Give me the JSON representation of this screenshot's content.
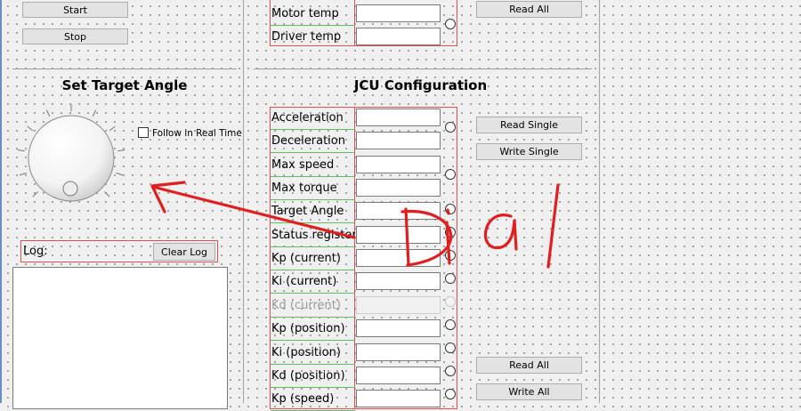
{
  "control_buttons": {
    "start": "Start",
    "stop": "Stop"
  },
  "monitor": {
    "rows": [
      {
        "label": "Motor temp"
      },
      {
        "label": "Driver temp"
      }
    ],
    "read_all": "Read All"
  },
  "target_angle": {
    "title": "Set Target Angle",
    "follow_label": "Follow in Real Time",
    "follow_checked": false
  },
  "log": {
    "label": "Log:",
    "clear_button": "Clear Log"
  },
  "jcu": {
    "title": "JCU Configuration",
    "read_single": "Read Single",
    "write_single": "Write Single",
    "read_all": "Read All",
    "write_all": "Write All",
    "rows": [
      {
        "label": "Acceleration",
        "enabled": true
      },
      {
        "label": "Deceleration",
        "enabled": true
      },
      {
        "label": "Max speed",
        "enabled": true
      },
      {
        "label": "Max torque",
        "enabled": true
      },
      {
        "label": "Target Angle",
        "enabled": true
      },
      {
        "label": "Status register",
        "enabled": true
      },
      {
        "label": "Kp (current)",
        "enabled": true
      },
      {
        "label": "Ki (current)",
        "enabled": true
      },
      {
        "label": "Kd (current)",
        "enabled": false
      },
      {
        "label": "Kp (position)",
        "enabled": true
      },
      {
        "label": "Ki (position)",
        "enabled": true
      },
      {
        "label": "Kd (position)",
        "enabled": true
      },
      {
        "label": "Kp (speed)",
        "enabled": true
      }
    ]
  },
  "annotation": {
    "text": "Dial",
    "color": "#e02020"
  }
}
